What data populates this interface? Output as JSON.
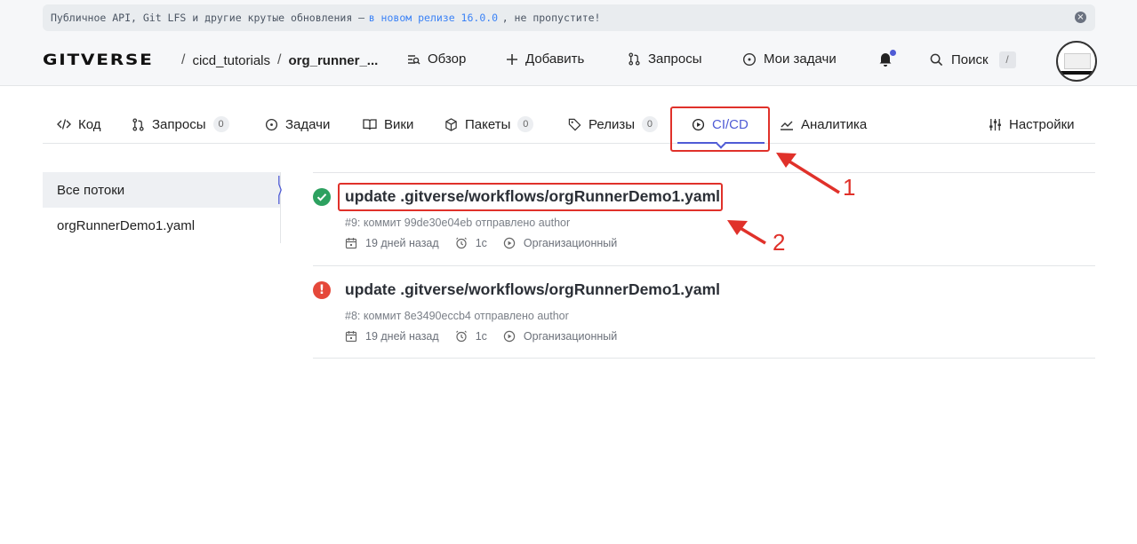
{
  "banner": {
    "text_before": "Публичное API, Git LFS и другие крутые обновления —",
    "link": "в новом релизе 16.0.0",
    "text_after": ", не пропустите!"
  },
  "header": {
    "logo": "GITVERSE",
    "breadcrumb": [
      "cicd_tutorials",
      "org_runner_..."
    ],
    "nav": [
      "Обзор",
      "Добавить",
      "Запросы",
      "Мои задачи"
    ],
    "search_label": "Поиск",
    "search_shortcut": "/"
  },
  "tabs": [
    {
      "label": "Код"
    },
    {
      "label": "Запросы",
      "count": "0"
    },
    {
      "label": "Задачи"
    },
    {
      "label": "Вики"
    },
    {
      "label": "Пакеты",
      "count": "0"
    },
    {
      "label": "Релизы",
      "count": "0"
    },
    {
      "label": "CI/CD",
      "active": true
    },
    {
      "label": "Аналитика"
    },
    {
      "label": "Настройки"
    }
  ],
  "sidebar": {
    "items": [
      "Все потоки",
      "orgRunnerDemo1.yaml"
    ]
  },
  "runs": [
    {
      "status": "success",
      "title": "update .gitverse/workflows/orgRunnerDemo1.yaml",
      "subtitle": "#9: коммит 99de30e04eb отправлено author",
      "age": "19 дней назад",
      "duration": "1с",
      "runner": "Организационный"
    },
    {
      "status": "error",
      "title": "update .gitverse/workflows/orgRunnerDemo1.yaml",
      "subtitle": "#8: коммит 8e3490eccb4 отправлено author",
      "age": "19 дней назад",
      "duration": "1с",
      "runner": "Организационный"
    }
  ],
  "annotations": [
    "1",
    "2"
  ],
  "colors": {
    "accent": "#4f5bd5",
    "success": "#2da160",
    "error": "#e5483a",
    "annotation": "#e0312a"
  }
}
